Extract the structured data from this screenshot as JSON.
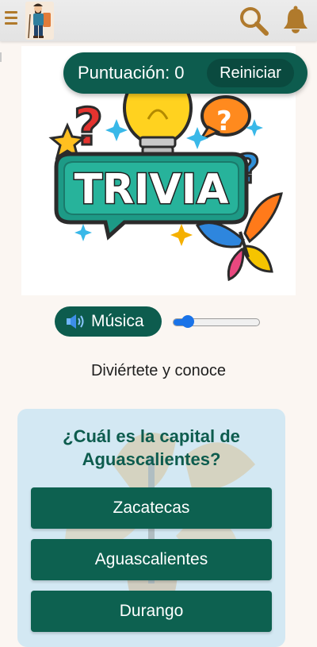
{
  "header": {
    "menu_icon": "hamburger-icon",
    "avatar_icon": "hiker-avatar",
    "search_icon": "search-icon",
    "bell_icon": "bell-icon",
    "accent_color": "#b07a2c"
  },
  "score": {
    "label": "Puntuación: 0",
    "reset_label": "Reiniciar",
    "color": "#0d5c4e"
  },
  "banner": {
    "title": "TRIVIA"
  },
  "music": {
    "label": "Música",
    "icon": "speaker-icon",
    "volume": 0.1
  },
  "tagline": "Diviértete y conoce",
  "question": {
    "text_line1": "¿Cuál es la capital de",
    "text_line2": "Aguascalientes?",
    "answers": [
      "Zacatecas",
      "Aguascalientes",
      "Durango"
    ]
  }
}
